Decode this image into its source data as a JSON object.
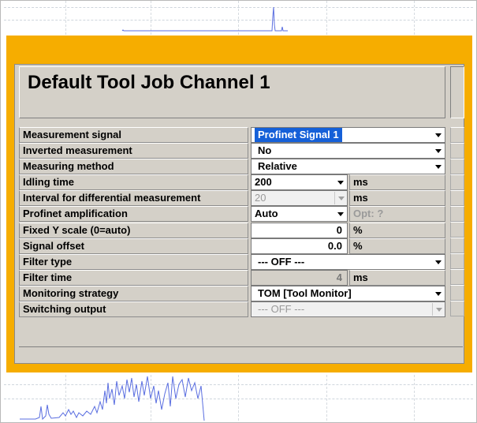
{
  "dialog": {
    "title": "Default Tool Job Channel 1"
  },
  "rows": [
    {
      "label": "Measurement signal",
      "value": "Profinet Signal 1"
    },
    {
      "label": "Inverted measurement",
      "value": "No"
    },
    {
      "label": "Measuring method",
      "value": "Relative"
    },
    {
      "label": "Idling time",
      "value": "200",
      "unit": "ms"
    },
    {
      "label": "Interval for differential measurement",
      "value": "20",
      "unit": "ms"
    },
    {
      "label": "Profinet amplification",
      "value": "Auto",
      "unit": "Opt: ?"
    },
    {
      "label": "Fixed Y scale (0=auto)",
      "value": "0",
      "unit": "%"
    },
    {
      "label": "Signal offset",
      "value": "0.0",
      "unit": "%"
    },
    {
      "label": "Filter type",
      "value": "--- OFF ---"
    },
    {
      "label": "Filter time",
      "value": "4",
      "unit": "ms"
    },
    {
      "label": "Monitoring strategy",
      "value": "TOM [Tool Monitor]"
    },
    {
      "label": "Switching output",
      "value": "--- OFF ---"
    }
  ],
  "colors": {
    "dialog_border": "#f6ad00",
    "panel": "#d4d0c8",
    "selection": "#1560d8",
    "trace": "#5a6ee0"
  }
}
